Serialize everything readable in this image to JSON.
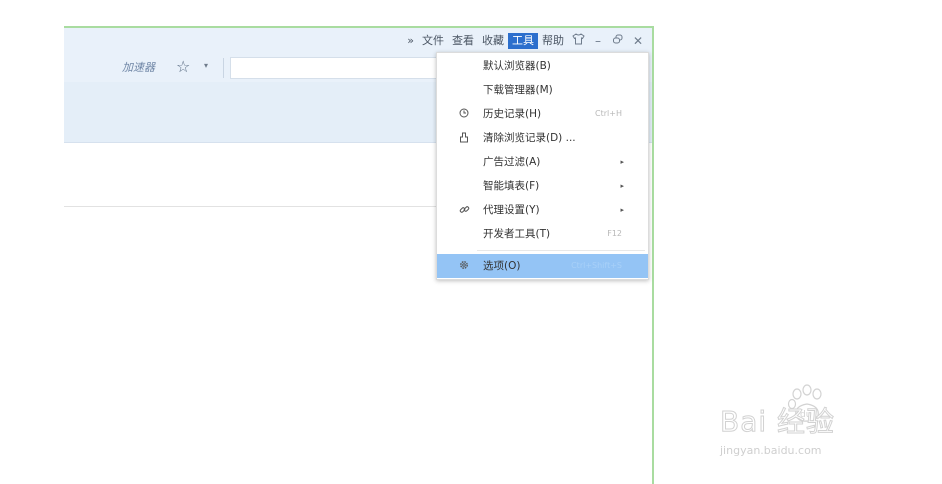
{
  "menubar": {
    "overflow": "»",
    "items": [
      "文件",
      "查看",
      "收藏",
      "工具",
      "帮助"
    ],
    "active_item": "工具",
    "controls": {
      "skin": "skin-icon",
      "minimize": "–",
      "restore": "restore-icon",
      "close": "✕"
    }
  },
  "toolbar": {
    "accelerator_label": "加速器",
    "star_glyph": "☆",
    "dropdown_glyph": "▾",
    "search_placeholder": ""
  },
  "tools_menu": {
    "items": [
      {
        "label": "默认浏览器(B)",
        "shortcut": "",
        "icon": "",
        "submenu": false,
        "highlighted": false
      },
      {
        "label": "下载管理器(M)",
        "shortcut": "",
        "icon": "",
        "submenu": false,
        "highlighted": false
      },
      {
        "label": "历史记录(H)",
        "shortcut": "Ctrl+H",
        "icon": "clock-icon",
        "submenu": false,
        "highlighted": false
      },
      {
        "label": "清除浏览记录(D) ...",
        "shortcut": "",
        "icon": "broom-icon",
        "submenu": false,
        "highlighted": false
      },
      {
        "label": "广告过滤(A)",
        "shortcut": "",
        "icon": "",
        "submenu": true,
        "highlighted": false
      },
      {
        "label": "智能填表(F)",
        "shortcut": "",
        "icon": "",
        "submenu": true,
        "highlighted": false
      },
      {
        "label": "代理设置(Y)",
        "shortcut": "",
        "icon": "link-icon",
        "submenu": true,
        "highlighted": false
      },
      {
        "label": "开发者工具(T)",
        "shortcut": "F12",
        "icon": "",
        "submenu": false,
        "highlighted": false
      },
      {
        "label": "选项(O)",
        "shortcut": "Ctrl+Shift+S",
        "icon": "gear-icon",
        "submenu": false,
        "highlighted": true
      }
    ],
    "submenu_arrow": "▸"
  },
  "watermark": {
    "brand": "Bai  经验",
    "url": "jingyan.baidu.com"
  },
  "colors": {
    "window_border": "#a9dca0",
    "menu_active_bg": "#2c6fcd",
    "item_highlight_bg": "#94c4f5",
    "toolbar_bg": "#e9f1fa"
  }
}
